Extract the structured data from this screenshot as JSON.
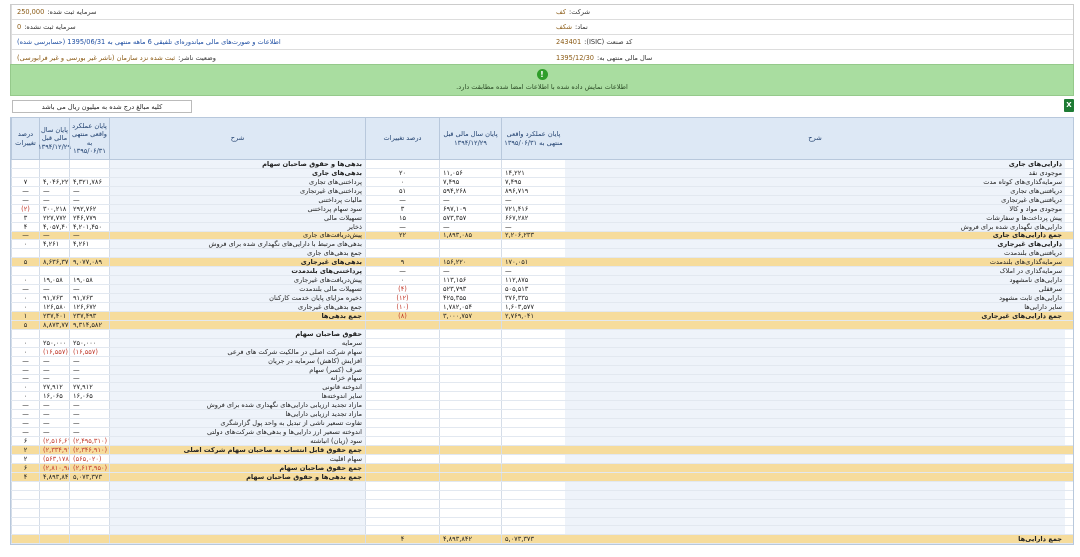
{
  "info": {
    "company_label": "شرکت:",
    "company": "کف",
    "symbol_label": "نماد:",
    "symbol": "شکف",
    "isic_label": "کد صنعت (ISIC):",
    "isic": "243401",
    "fiscal_year_label": "سال مالی منتهی به:",
    "fiscal_year": "1395/12/30",
    "reg_capital_label": "سرمایه ثبت شده:",
    "reg_capital": "250,000",
    "unreg_capital_label": "سرمایه ثبت نشده:",
    "unreg_capital": "0",
    "report_title": "اطلاعات و صورت‌های مالی میاندوره‌ای تلفیقی 6 ماهه منتهی به 1395/06/31 (حسابرسی شده)",
    "publisher_status_label": "وضعیت ناشر:",
    "publisher_status": "ثبت شده نزد سازمان (ناشر غیر بورسی و غیر فرابورسی)"
  },
  "notice": {
    "icon": "info-icon",
    "text": "اطلاعات نمایش داده شده با اطلاعات امضا شده مطابقت دارد."
  },
  "note": {
    "text": "کلیه مبالغ درج شده به میلیون ریال می باشد"
  },
  "headers": {
    "h1": "درصد تغییرات",
    "h2": "پایان سال مالی قبل ۱۳۹۴/۱۲/۲۹",
    "h3": "پایان عملکرد واقعی منتهی به ۱۳۹۵/۰۶/۳۱",
    "h4": "شرح",
    "h5": "درصد تغییرات",
    "h6": "پایان سال مالی قبل ۱۳۹۴/۱۲/۲۹",
    "h7": "پایان عملکرد واقعی منتهی به ۱۳۹۵/۰۶/۳۱",
    "h8": "شرح"
  },
  "assets": [
    {
      "label": "دارایی‌های جاری",
      "b": true
    },
    {
      "label": "موجودی نقد",
      "cur": "۱۴,۲۲۱",
      "prev": "۱۱,۰۵۶",
      "pct": "۲۰"
    },
    {
      "label": "سرمایه‌گذاری‌های کوتاه مدت",
      "cur": "۷,۴۹۵",
      "prev": "۷,۴۹۵",
      "pct": "۰"
    },
    {
      "label": "دریافتنی‌های تجاری",
      "cur": "۸۹۶,۷۱۹",
      "prev": "۵۹۴,۲۶۸",
      "pct": "۵۱"
    },
    {
      "label": "دریافتنی‌های غیرتجاری",
      "cur": "—",
      "prev": "—",
      "pct": "—"
    },
    {
      "label": "موجودی مواد و کالا",
      "cur": "۷۲۱,۴۱۶",
      "prev": "۶۹۷,۱۰۹",
      "pct": "۳"
    },
    {
      "label": "پیش پرداخت‌ها و سفارشات",
      "cur": "۶۶۷,۲۸۲",
      "prev": "۵۷۳,۳۵۷",
      "pct": "۱۵"
    },
    {
      "label": "دارایی‌های نگهداری شده برای فروش",
      "cur": "—",
      "prev": "—",
      "pct": "—"
    },
    {
      "label": "جمع دارایی‌های جاری",
      "cur": "۲,۲۰۶,۲۳۳",
      "prev": "۱,۸۹۳,۰۸۵",
      "pct": "۲۲",
      "tot": true
    },
    {
      "label": "دارایی‌های غیرجاری",
      "b": true
    },
    {
      "label": "دریافتنی‌های بلندمدت",
      "cur": "",
      "prev": "",
      "pct": ""
    },
    {
      "label": "سرمایه‌گذاری‌های بلندمدت",
      "cur": "۱۷۰,۰۵۱",
      "prev": "۱۵۶,۲۲۰",
      "pct": "۹"
    },
    {
      "label": "سرمایه‌گذاری در املاک",
      "cur": "—",
      "prev": "—",
      "pct": "—"
    },
    {
      "label": "دارایی‌های نامشهود",
      "cur": "۱۱۲,۸۷۵",
      "prev": "۱۱۳,۱۵۶",
      "pct": "۰"
    },
    {
      "label": "سرقفلی",
      "cur": "۵۰۵,۵۱۳",
      "prev": "۵۲۳,۷۹۳",
      "pct": "(۴)",
      "neg": true
    },
    {
      "label": "دارایی‌های ثابت مشهود",
      "cur": "۳۷۶,۳۳۵",
      "prev": "۴۲۵,۳۵۵",
      "pct": "(۱۲)",
      "neg": true
    },
    {
      "label": "سایر دارایی‌ها",
      "cur": "۱,۶۰۳,۵۷۷",
      "prev": "۱,۷۸۲,۰۵۴",
      "pct": "(۱۰)",
      "neg": true
    },
    {
      "label": "جمع دارایی‌های غیرجاری",
      "cur": "۲,۷۶۹,۰۴۱",
      "prev": "۳,۰۰۰,۷۵۷",
      "pct": "(۸)",
      "tot": true,
      "neg": true
    }
  ],
  "liabilities": [
    {
      "label": "بدهی‌ها و حقوق صاحبان سهام",
      "b": true
    },
    {
      "label": "بدهی‌های جاری",
      "b": true
    },
    {
      "label": "پرداختنی‌های تجاری",
      "cur": "۴,۳۲۱,۷۸۶",
      "prev": "۴,۰۴۶,۲۲۲",
      "pct": "۷"
    },
    {
      "label": "پرداختنی‌های غیرتجاری",
      "cur": "—",
      "prev": "—",
      "pct": "—"
    },
    {
      "label": "مالیات پرداختنی",
      "cur": "—",
      "prev": "—",
      "pct": "—"
    },
    {
      "label": "سود سهام پرداختنی",
      "cur": "۲۹۲,۷۶۲",
      "prev": "۳۰۰,۲۱۸",
      "pct": "(۲)",
      "neg": true
    },
    {
      "label": "تسهیلات مالی",
      "cur": "۲۴۶,۷۷۹",
      "prev": "۲۲۷,۷۷۲",
      "pct": "۳"
    },
    {
      "label": "ذخایر",
      "cur": "۴,۲۰۱,۴۵۰",
      "prev": "۴,۰۵۷,۴۰۲",
      "pct": "۴"
    },
    {
      "label": "پیش‌دریافت‌های جاری",
      "cur": "—",
      "prev": "—",
      "pct": "—"
    },
    {
      "label": "بدهی‌های مرتبط با دارایی‌های نگهداری شده برای فروش",
      "cur": "۴,۲۶۱",
      "prev": "۴,۲۶۱",
      "pct": "۰"
    },
    {
      "label": "جمع بدهی‌های جاری",
      "cur": "",
      "prev": "",
      "pct": ""
    },
    {
      "label": "بدهی‌های غیرجاری",
      "cur": "۹,۰۷۷,۰۸۹",
      "prev": "۸,۶۳۶,۳۷۶",
      "pct": "۵",
      "tot": true
    },
    {
      "label": "پرداختنی‌های بلندمدت",
      "b": true
    },
    {
      "label": "پیش‌دریافت‌های غیرجاری",
      "cur": "۱۹,۰۵۸",
      "prev": "۱۹,۰۵۸",
      "pct": "۰"
    },
    {
      "label": "تسهیلات مالی بلندمدت",
      "cur": "—",
      "prev": "—",
      "pct": "—"
    },
    {
      "label": "ذخیره مزایای پایان خدمت کارکنان",
      "cur": "۹۱,۷۶۳",
      "prev": "۹۱,۷۶۳",
      "pct": "۰"
    },
    {
      "label": "جمع بدهی‌های غیرجاری",
      "cur": "۱۲۶,۶۷۲",
      "prev": "۱۲۶,۵۸۰",
      "pct": "۰"
    },
    {
      "label": "جمع بدهی‌ها",
      "cur": "۲۳۷,۴۹۳",
      "prev": "۲۳۷,۴۰۱",
      "pct": "۱",
      "tot": true
    },
    {
      "label": "",
      "cur": "۹,۳۱۴,۵۸۲",
      "prev": "۸,۸۷۳,۷۷۷",
      "pct": "۵",
      "tot": true
    }
  ],
  "equity": [
    {
      "label": "حقوق صاحبان سهام",
      "b": true
    },
    {
      "label": "سرمایه",
      "cur": "۲۵۰,۰۰۰",
      "prev": "۲۵۰,۰۰۰",
      "pct": "۰"
    },
    {
      "label": "سهام شرکت اصلی در مالکیت شرکت های فرعی",
      "cur": "(۱۶,۵۵۷)",
      "prev": "(۱۶,۵۵۷)",
      "pct": "۰",
      "neg": true
    },
    {
      "label": "افزایش (کاهش) سرمایه در جریان",
      "cur": "—",
      "prev": "—",
      "pct": "—"
    },
    {
      "label": "صرف (کسر) سهام",
      "cur": "—",
      "prev": "—",
      "pct": "—"
    },
    {
      "label": "سهام خزانه",
      "cur": "—",
      "prev": "—",
      "pct": "—"
    },
    {
      "label": "اندوخته قانونی",
      "cur": "۲۷,۹۱۲",
      "prev": "۲۷,۹۱۲",
      "pct": "۰"
    },
    {
      "label": "سایر اندوخته‌ها",
      "cur": "۱۶,۰۶۵",
      "prev": "۱۶,۰۶۵",
      "pct": "۰"
    },
    {
      "label": "مازاد تجدید ارزیابی دارایی‌های نگهداری شده برای فروش",
      "cur": "—",
      "prev": "—",
      "pct": "—"
    },
    {
      "label": "مازاد تجدید ارزیابی دارایی‌ها",
      "cur": "—",
      "prev": "—",
      "pct": "—"
    },
    {
      "label": "تفاوت تسعیر ناشی از تبدیل به واحد پول گزارشگری",
      "cur": "—",
      "prev": "—",
      "pct": "—"
    },
    {
      "label": "اندوخته تسعیر ارز دارایی‌ها و بدهی‌های شرکت‌های دولتی",
      "cur": "—",
      "prev": "—",
      "pct": "—"
    },
    {
      "label": "سود (زیان) انباشته",
      "cur": "(۲,۴۹۵,۳۱۰)",
      "prev": "(۲,۵۱۶,۶۱۷)",
      "pct": "۶",
      "neg": true
    },
    {
      "label": "جمع حقوق قابل انتساب به صاحبان سهام شرکت اصلی",
      "cur": "(۲,۳۴۶,۹۱۰)",
      "prev": "(۲,۳۳۴,۹۱۷)",
      "pct": "۲",
      "tot": true,
      "neg": true
    },
    {
      "label": "سهام اقلیت",
      "cur": "(۵۶۵,۰۲۰)",
      "prev": "(۵۶۳,۱۷۸)",
      "pct": "۲",
      "neg": true
    },
    {
      "label": "جمع حقوق صاحبان سهام",
      "cur": "(۲,۶۱۳,۹۵۰)",
      "prev": "(۲,۸۱۰,۹۸۲)",
      "pct": "۶",
      "tot": true,
      "neg": true
    },
    {
      "label": "جمع بدهی‌ها و حقوق صاحبان سهام",
      "cur": "۵,۰۷۳,۳۷۳",
      "prev": "۴,۸۹۳,۸۴۲",
      "pct": "۴",
      "tot": true
    }
  ],
  "total_assets": {
    "label": "جمع دارایی‌ها",
    "cur": "۵,۰۷۳,۳۷۳",
    "prev": "۴,۸۹۳,۸۴۲",
    "pct": "۴"
  }
}
